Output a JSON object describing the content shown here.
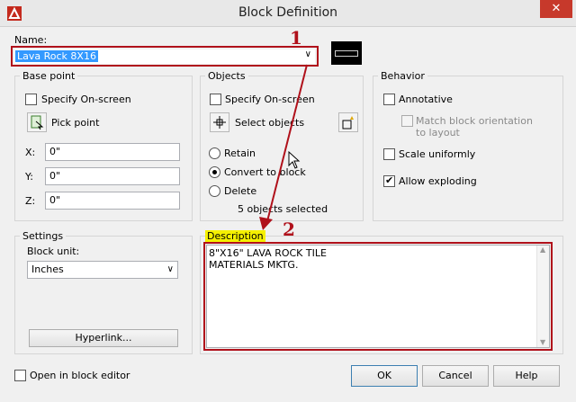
{
  "window": {
    "title": "Block Definition",
    "close_glyph": "✕"
  },
  "name": {
    "label": "Name:",
    "value": "Lava Rock 8X16",
    "annotation_number": "1"
  },
  "base_point": {
    "label": "Base point",
    "specify_label": "Specify On-screen",
    "pick_label": "Pick point",
    "x_label": "X:",
    "x_value": "0\"",
    "y_label": "Y:",
    "y_value": "0\"",
    "z_label": "Z:",
    "z_value": "0\""
  },
  "objects": {
    "label": "Objects",
    "specify_label": "Specify On-screen",
    "select_label": "Select objects",
    "retain_label": "Retain",
    "convert_label": "Convert to block",
    "delete_label": "Delete",
    "status": "5 objects selected"
  },
  "behavior": {
    "label": "Behavior",
    "annotative_label": "Annotative",
    "match_label_1": "Match block orientation",
    "match_label_2": "to layout",
    "scale_label": "Scale uniformly",
    "explode_label": "Allow exploding"
  },
  "settings": {
    "label": "Settings",
    "unit_label": "Block unit:",
    "unit_value": "Inches",
    "hyperlink_label": "Hyperlink..."
  },
  "description": {
    "label": "Description",
    "line1": "8\"X16\" LAVA ROCK TILE",
    "line2": "MATERIALS MKTG.",
    "annotation_number": "2"
  },
  "footer": {
    "open_label": "Open in block editor",
    "ok_label": "OK",
    "cancel_label": "Cancel",
    "help_label": "Help"
  },
  "colors": {
    "annotation": "#b0111b",
    "highlight": "#f5f000",
    "selection": "#3399ff"
  }
}
